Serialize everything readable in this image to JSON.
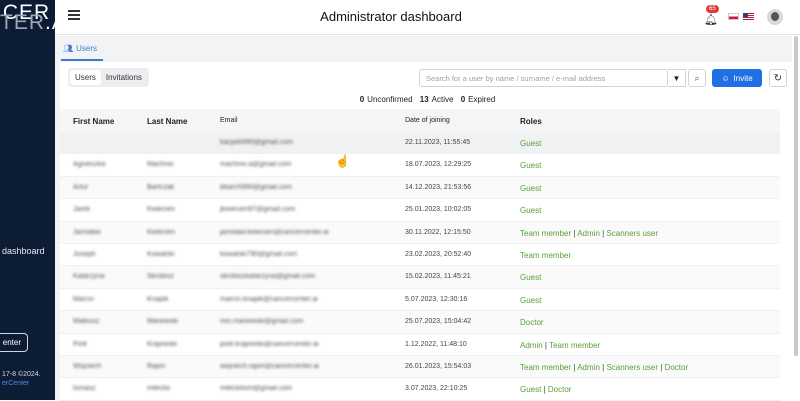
{
  "sidebar": {
    "logo_line1": "ICER",
    "logo_line2a": "TER",
    "logo_line2b": ".AI",
    "nav_item": "dashboard",
    "button": "enter",
    "footer_line1": "17-8 ©2024.",
    "footer_line2": "erCenter"
  },
  "header": {
    "title": "Administrator dashboard",
    "notification_count": "65"
  },
  "tabs": {
    "users": "Users"
  },
  "segmented": {
    "users": "Users",
    "invitations": "Invitations"
  },
  "search": {
    "placeholder": "Search for a user by name / surname / e-mail address"
  },
  "invite_label": "Invite",
  "counts": {
    "unconfirmed_value": "0",
    "unconfirmed_label": "Unconfirmed",
    "active_value": "13",
    "active_label": "Active",
    "expired_value": "0",
    "expired_label": "Expired"
  },
  "table": {
    "headers": {
      "first": "First Name",
      "last": "Last Name",
      "email": "Email",
      "date": "Date of joining",
      "roles": "Roles"
    },
    "rows": [
      {
        "first": "",
        "last": "",
        "email": "kacpek990@gmail.com",
        "date": "22.11.2023, 11:55:45",
        "roles": [
          "Guest"
        ]
      },
      {
        "first": "Agnieszka",
        "last": "Machnio",
        "email": "machnio.a@gmail.com",
        "date": "18.07.2023, 12:29:25",
        "roles": [
          "Guest"
        ]
      },
      {
        "first": "Artur",
        "last": "Bartczak",
        "email": "bbarch990@gmail.com",
        "date": "14.12.2023, 21:53:56",
        "roles": [
          "Guest"
        ]
      },
      {
        "first": "Jarek",
        "last": "Kwiecien",
        "email": "jkwiecien97@gmail.com",
        "date": "25.01.2023, 10:02:05",
        "roles": [
          "Guest"
        ]
      },
      {
        "first": "Jarosław",
        "last": "Kwiecien",
        "email": "jaroslaw.kwiecien@cancercenter.ai",
        "date": "30.11.2022, 12:15:50",
        "roles": [
          "Team member",
          "Admin",
          "Scanners user"
        ]
      },
      {
        "first": "Joseph",
        "last": "Kowalski",
        "email": "kowalski790@gmail.com",
        "date": "23.02.2023, 20:52:40",
        "roles": [
          "Team member"
        ]
      },
      {
        "first": "Katarzyna",
        "last": "Skrobisz",
        "email": "skrobiszkatarzyna@gmail.com",
        "date": "15.02.2023, 11:45:21",
        "roles": [
          "Guest"
        ]
      },
      {
        "first": "Marcin",
        "last": "Knapik",
        "email": "marcin.knapik@cancercenter.ai",
        "date": "5.07.2023, 12:30:16",
        "roles": [
          "Guest"
        ]
      },
      {
        "first": "Mateusz",
        "last": "Mariewski",
        "email": "min.mariewski@gmail.com",
        "date": "25.07.2023, 15:04:42",
        "roles": [
          "Doctor"
        ]
      },
      {
        "first": "Piotr",
        "last": "Krajewski",
        "email": "piotr.krajewski@cancercenter.ai",
        "date": "1.12.2022, 11:48:10",
        "roles": [
          "Admin",
          "Team member"
        ]
      },
      {
        "first": "Wojciech",
        "last": "Rajon",
        "email": "wojciech.rajon@cancercenter.ai",
        "date": "26.01.2023, 15:54:03",
        "roles": [
          "Team member",
          "Admin",
          "Scanners user",
          "Doctor"
        ]
      },
      {
        "first": "tomasz",
        "last": "mileckii",
        "email": "mileckitom@gmail.com",
        "date": "3.07.2023, 22:10:25",
        "roles": [
          "Guest",
          "Doctor"
        ]
      }
    ]
  },
  "colors": {
    "accent": "#1f6fe5",
    "sidebar": "#0b1c34",
    "role_link": "#5a9e3a",
    "badge": "#e53935"
  },
  "icons": {
    "menu": "hamburger-icon",
    "bell": "bell-icon",
    "filter": "filter-icon",
    "search": "search-icon",
    "invite": "user-icon",
    "refresh": "refresh-icon",
    "cursor": "hand-cursor-icon"
  }
}
